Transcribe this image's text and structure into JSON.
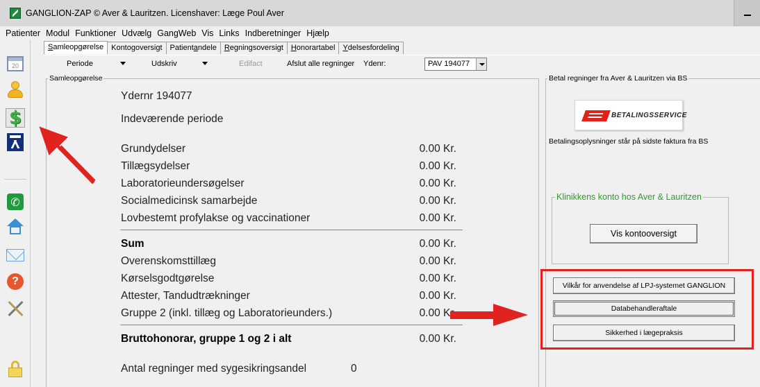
{
  "titlebar": {
    "title": "GANGLION-ZAP  © Aver & Lauritzen.  Licenshaver: Læge Poul Aver",
    "minimize_icon": "minimize-icon"
  },
  "menu": [
    "Patienter",
    "Modul",
    "Funktioner",
    "Udvælg",
    "GangWeb",
    "Vis",
    "Links",
    "Indberetninger",
    "Hjælp"
  ],
  "toolbar": {
    "calendar_day": "20",
    "icons": [
      "calendar-icon",
      "user-icon",
      "dollar-icon",
      "ganglion-logo-icon",
      "phone-icon",
      "home-icon",
      "mail-icon",
      "help-icon",
      "tools-icon",
      "lock-icon"
    ]
  },
  "tabs": [
    {
      "pre": "",
      "acc": "S",
      "post": "amleopgørelse"
    },
    {
      "pre": "Konto",
      "acc": "g",
      "post": "oversigt"
    },
    {
      "pre": "Patient",
      "acc": "a",
      "post": "ndele"
    },
    {
      "pre": "",
      "acc": "R",
      "post": "egningsoversigt"
    },
    {
      "pre": "",
      "acc": "H",
      "post": "onorartabel"
    },
    {
      "pre": "",
      "acc": "Y",
      "post": "delsesfordeling"
    }
  ],
  "subbar": {
    "periode": "Periode",
    "udskriv": "Udskriv",
    "edifact": "Edifact",
    "afslut": "Afslut alle regninger",
    "ydenr_label": "Ydenr:",
    "ydenr_value": "PAV 194077"
  },
  "summary": {
    "legend": "Samleopgørelse",
    "ydernr": "Ydernr 194077",
    "periode": "Indeværende periode",
    "rows": [
      {
        "label": "Grundydelser",
        "value": "0.00 Kr."
      },
      {
        "label": "Tillægsydelser",
        "value": "0.00 Kr."
      },
      {
        "label": "Laboratorieundersøgelser",
        "value": "0.00 Kr."
      },
      {
        "label": "Socialmedicinsk samarbejde",
        "value": "0.00 Kr."
      },
      {
        "label": "Lovbestemt profylakse og vaccinationer",
        "value": "0.00 Kr."
      },
      {
        "label": "Sum",
        "value": "0.00 Kr."
      },
      {
        "label": "Overenskomsttillæg",
        "value": "0.00 Kr."
      },
      {
        "label": "Kørselsgodtgørelse",
        "value": "0.00 Kr."
      },
      {
        "label": "Attester, Tandudtrækninger",
        "value": "0.00 Kr."
      },
      {
        "label": "Gruppe 2 (inkl. tillæg og Laboratorieunders.)",
        "value": "0.00 Kr."
      },
      {
        "label": "Bruttohonorar, gruppe 1 og 2 i alt",
        "value": "0.00 Kr."
      }
    ],
    "antal_label": "Antal regninger med sygesikringsandel",
    "antal_value": "0"
  },
  "bs": {
    "legend": "Betal regninger fra Aver & Lauritzen via BS",
    "logo_text": "BETALINGSSERVICE",
    "info": "Betalingsoplysninger står på sidste faktura fra BS"
  },
  "konto": {
    "legend": "Klinikkens konto hos Aver & Lauritzen",
    "button": "Vis kontooversigt"
  },
  "actions": {
    "vilkaar": "Vilkår for anvendelse af LPJ-systemet GANGLION",
    "databehandler": "Databehandleraftale",
    "sikkerhed": "Sikkerhed i lægepraksis"
  },
  "colors": {
    "annotation_red": "#e1231f",
    "konto_legend_green": "#2e9a2e",
    "bs_red": "#e32119"
  }
}
